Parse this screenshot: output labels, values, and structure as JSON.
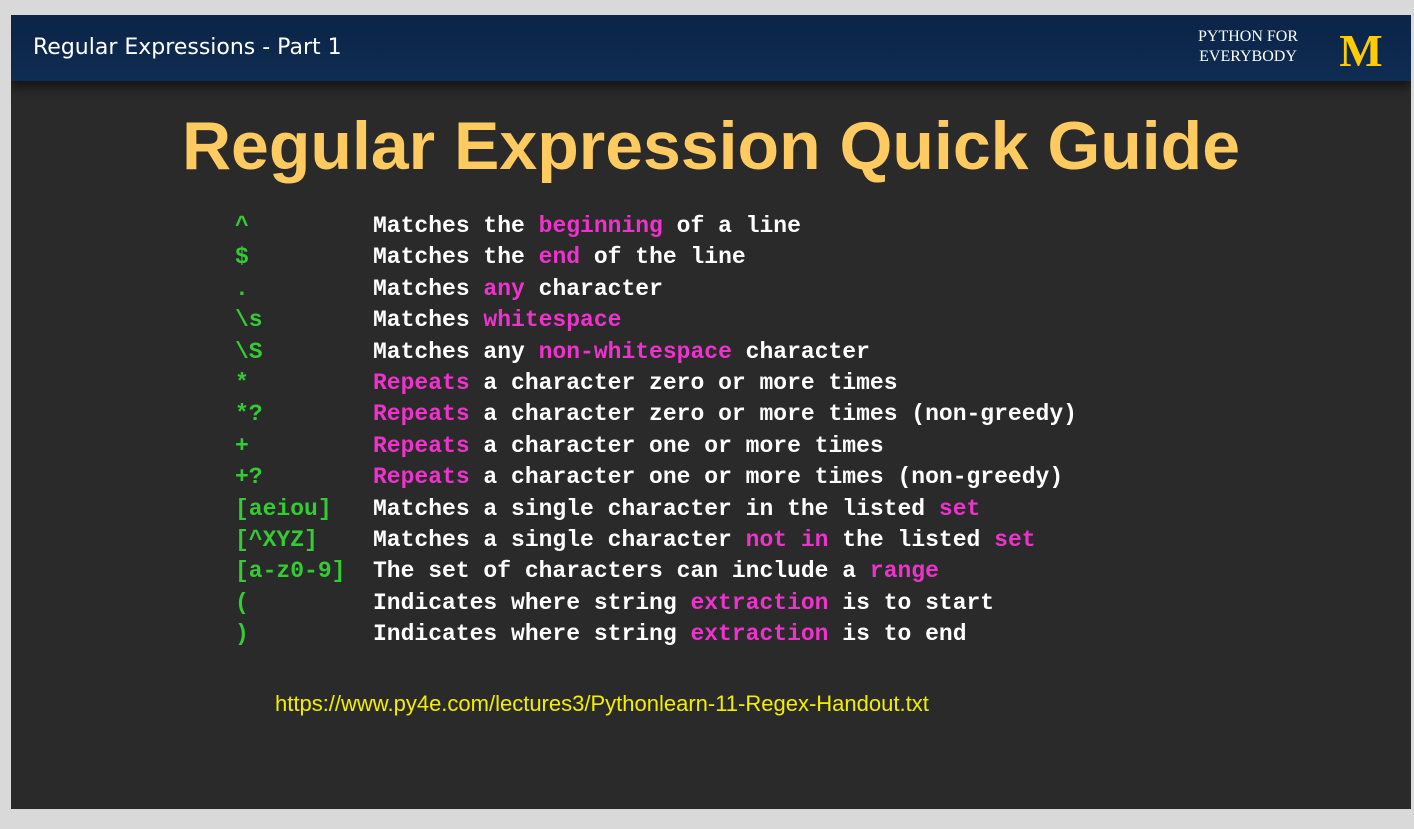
{
  "header": {
    "title": "Regular Expressions - Part 1",
    "brand_line1": "PYTHON FOR",
    "brand_line2": "EVERYBODY",
    "logo_text": "M"
  },
  "slide": {
    "title": "Regular Expression Quick Guide",
    "url": "https://www.py4e.com/lectures3/Pythonlearn-11-Regex-Handout.txt"
  },
  "colors": {
    "title": "#ffcb60",
    "symbol": "#33cc33",
    "highlight": "#ee33cc",
    "url": "#f2ee00",
    "header_bg": "#0b2447",
    "logo": "#ffcb05"
  },
  "rows": [
    {
      "symbol": "^",
      "pre": "Matches the ",
      "hl": "beginning",
      "post": " of a line"
    },
    {
      "symbol": "$",
      "pre": "Matches the ",
      "hl": "end",
      "post": " of the line"
    },
    {
      "symbol": ".",
      "pre": "Matches ",
      "hl": "any",
      "post": " character"
    },
    {
      "symbol": "\\s",
      "pre": "Matches ",
      "hl": "whitespace",
      "post": ""
    },
    {
      "symbol": "\\S",
      "pre": "Matches any ",
      "hl": "non-whitespace",
      "post": " character"
    },
    {
      "symbol": "*",
      "pre": "",
      "hl": "Repeats",
      "post": " a character zero or more times"
    },
    {
      "symbol": "*?",
      "pre": "",
      "hl": "Repeats",
      "post": " a character zero or more times (non-greedy)"
    },
    {
      "symbol": "+",
      "pre": "",
      "hl": "Repeats",
      "post": " a character one or more times"
    },
    {
      "symbol": "+?",
      "pre": "",
      "hl": "Repeats",
      "post": " a character one or more times (non-greedy)"
    },
    {
      "symbol": "[aeiou]",
      "pre": "Matches a single character in the listed ",
      "hl": "set",
      "post": ""
    },
    {
      "symbol": "[^XYZ]",
      "pre": "Matches a single character ",
      "hl": "not in",
      "post": " the listed ",
      "hl2": "set"
    },
    {
      "symbol": "[a-z0-9]",
      "pre": "The set of characters can include a ",
      "hl": "range",
      "post": ""
    },
    {
      "symbol": "(",
      "pre": "Indicates where string ",
      "hl": "extraction",
      "post": " is to start"
    },
    {
      "symbol": ")",
      "pre": "Indicates where string ",
      "hl": "extraction",
      "post": " is to end"
    }
  ]
}
